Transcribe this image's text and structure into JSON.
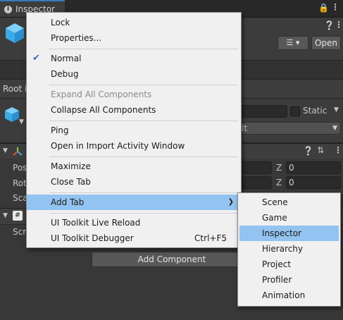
{
  "tab": {
    "title": "Inspector"
  },
  "header": {
    "open_label": "Open"
  },
  "root_text": "Root i",
  "object": {
    "static_label": "Static",
    "dropdown_value": "lt"
  },
  "transform": {
    "rows": [
      "Pos",
      "Rot",
      "Sca"
    ],
    "z_label": "Z",
    "z_values": [
      "0",
      "0"
    ]
  },
  "script_component": {
    "label": "Scr"
  },
  "add_component_label": "Add Component",
  "context_menu": {
    "items": [
      {
        "label": "Lock",
        "disabled": false
      },
      {
        "label": "Properties...",
        "disabled": false
      },
      {
        "label": "Normal",
        "checked": true
      },
      {
        "label": "Debug",
        "disabled": false
      },
      {
        "label": "Expand All Components",
        "disabled": true
      },
      {
        "label": "Collapse All Components",
        "disabled": false
      },
      {
        "label": "Ping",
        "disabled": false
      },
      {
        "label": "Open in Import Activity Window",
        "disabled": false
      },
      {
        "label": "Maximize",
        "disabled": false
      },
      {
        "label": "Close Tab",
        "disabled": false
      },
      {
        "label": "Add Tab",
        "highlighted": true,
        "has_submenu": true
      },
      {
        "label": "UI Toolkit Live Reload",
        "disabled": false
      },
      {
        "label": "UI Toolkit Debugger",
        "shortcut": "Ctrl+F5"
      }
    ]
  },
  "add_tab_submenu": {
    "items": [
      "Scene",
      "Game",
      "Inspector",
      "Hierarchy",
      "Project",
      "Profiler",
      "Animation"
    ],
    "highlighted": "Inspector"
  },
  "colors": {
    "accent_blue": "#3a79bb",
    "menu_highlight": "#93c3f0",
    "cube_blue": "#4fb8f0"
  }
}
